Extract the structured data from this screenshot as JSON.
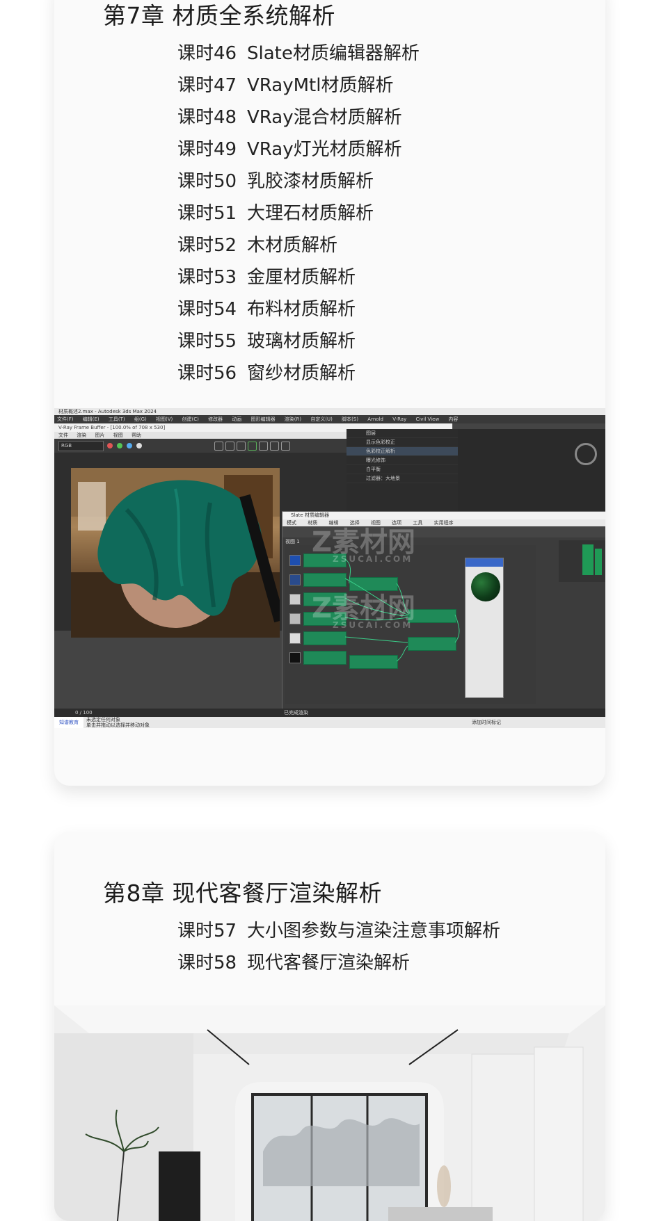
{
  "chapter7": {
    "title": "第7章 材质全系统解析",
    "lessons": [
      {
        "num": "课时46",
        "name": "Slate材质编辑器解析"
      },
      {
        "num": "课时47",
        "name": "VRayMtl材质解析"
      },
      {
        "num": "课时48",
        "name": "VRay混合材质解析"
      },
      {
        "num": "课时49",
        "name": "VRay灯光材质解析"
      },
      {
        "num": "课时50",
        "name": "乳胶漆材质解析"
      },
      {
        "num": "课时51",
        "name": "大理石材质解析"
      },
      {
        "num": "课时52",
        "name": "木材质解析"
      },
      {
        "num": "课时53",
        "name": "金厘材质解析"
      },
      {
        "num": "课时54",
        "name": "布料材质解析"
      },
      {
        "num": "课时55",
        "name": "玻璃材质解析"
      },
      {
        "num": "课时56",
        "name": "窗纱材质解析"
      }
    ],
    "screenshot": {
      "window_title": "材质概述2.max - Autodesk 3ds Max 2024",
      "menu": [
        "文件(F)",
        "编辑(E)",
        "工具(T)",
        "组(G)",
        "视图(V)",
        "创建(C)",
        "修改器",
        "动画",
        "图形编辑器",
        "渲染(R)",
        "自定义(U)",
        "脚本(S)",
        "Arnold",
        "V-Ray",
        "Civil View",
        "内容"
      ],
      "vfb_title": "V-Ray Frame Buffer - [100.0% of 708 x 530]",
      "vfb_menu": [
        "文件",
        "渲染",
        "图片",
        "视图",
        "帮助"
      ],
      "vfb_channel": "RGB",
      "layers": [
        "图层",
        "显示色彩校正",
        "色彩校正解析",
        "曝光修饰",
        "白平衡",
        "过滤器：大地景"
      ],
      "slate_title": "Slate 材质编辑器",
      "slate_menu": [
        "模式",
        "材质",
        "编辑",
        "选择",
        "视图",
        "选项",
        "工具",
        "实用程序"
      ],
      "slate_tab": "视图 1",
      "status_logo": "知谱教育",
      "status_text_1": "未选定任何对象",
      "status_text_2": "单击并拖动以选择并移动对象",
      "timeline": "0 / 100",
      "add_time_tag": "添加时间标记",
      "render_status": "已完成渲染"
    }
  },
  "watermark": {
    "brand": "Z素材网",
    "url": "ZSUCAI.COM"
  },
  "chapter8": {
    "title": "第8章 现代客餐厅渲染解析",
    "lessons": [
      {
        "num": "课时57",
        "name": "大小图参数与渲染注意事项解析"
      },
      {
        "num": "课时58",
        "name": "现代客餐厅渲染解析"
      }
    ]
  },
  "colors": {
    "card_bg": "#fafafa",
    "node_green": "#1f8a58",
    "ui_dark": "#3c3c3c",
    "cloth_green": "#0f6a5a"
  }
}
